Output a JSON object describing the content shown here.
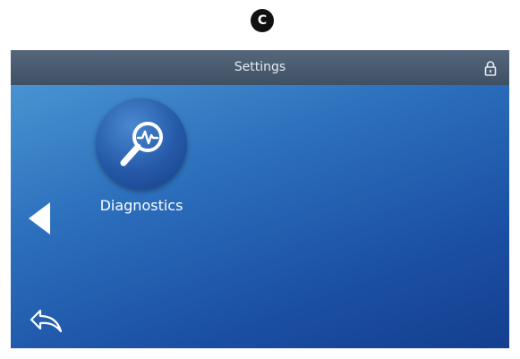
{
  "marker": {
    "label": "C"
  },
  "header": {
    "title": "Settings",
    "lock_icon": "lock-icon"
  },
  "tiles": [
    {
      "label": "Diagnostics",
      "icon": "diagnostics-magnifier-icon"
    }
  ],
  "navigation": {
    "back_icon": "left-arrow-icon",
    "return_icon": "return-arrow-icon"
  },
  "colors": {
    "header_bar": "#46586c",
    "screen_top": "#4f9bd6",
    "screen_bottom": "#143f8f",
    "tile_circle": "#2559a8",
    "text": "#ffffff"
  }
}
